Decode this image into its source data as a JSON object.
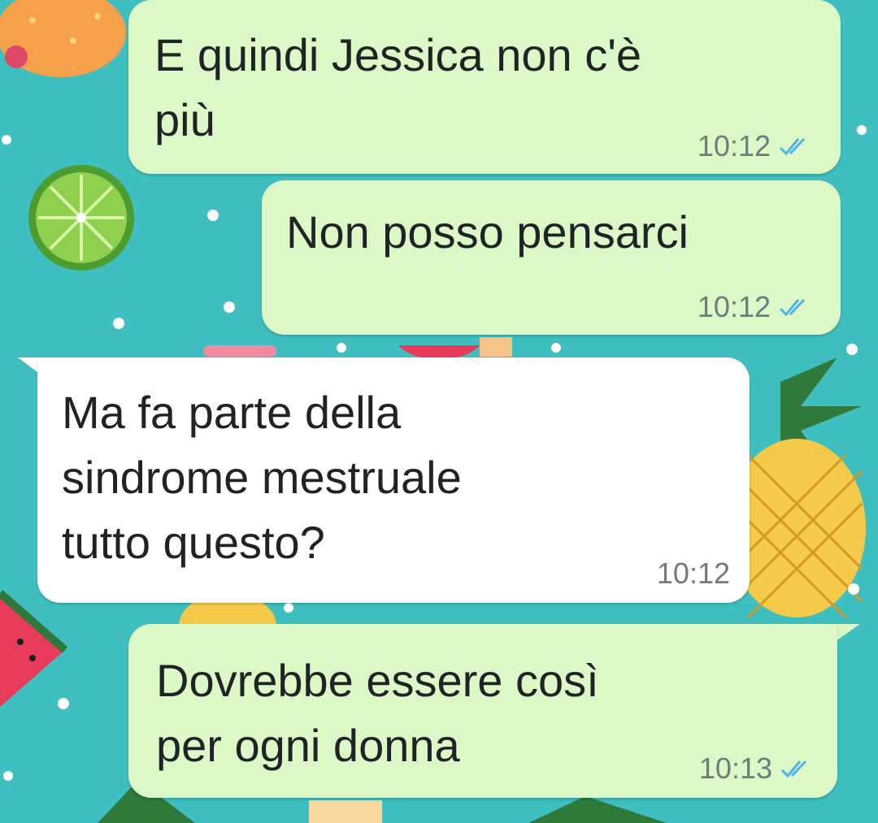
{
  "chat": {
    "messages": [
      {
        "direction": "outgoing",
        "text": "E quindi Jessica non c'è\npiù",
        "time": "10:12",
        "status": "read-double-check-icon"
      },
      {
        "direction": "outgoing",
        "text": "Non posso pensarci",
        "time": "10:12",
        "status": "read-double-check-icon"
      },
      {
        "direction": "incoming",
        "text": "Ma fa parte della\nsindrome mestruale\ntutto questo?",
        "time": "10:12"
      },
      {
        "direction": "outgoing",
        "text": "Dovrebbe essere così\nper ogni donna",
        "time": "10:13",
        "status": "read-double-check-icon"
      }
    ]
  },
  "colors": {
    "wallpaper": "#3fbfbf",
    "outgoing_bubble": "#dcf8c6",
    "incoming_bubble": "#ffffff",
    "read_tick": "#4fb3ea",
    "timestamp": "#6f7b80"
  },
  "wallpaper_motifs": [
    "ice-cream-icon",
    "lime-slice-icon",
    "pineapple-icon",
    "watermelon-slice-icon",
    "orange-slice-icon",
    "popsicle-icon"
  ]
}
